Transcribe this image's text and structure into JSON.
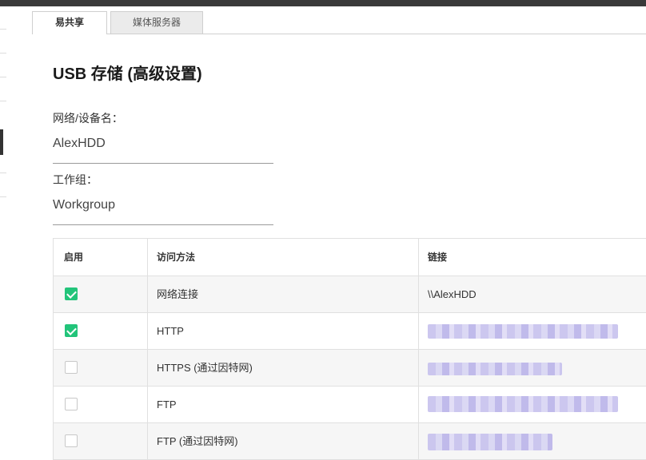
{
  "tabs": [
    {
      "label": "易共享",
      "active": true
    },
    {
      "label": "媒体服务器",
      "active": false
    }
  ],
  "page": {
    "title": "USB 存储 (高级设置)"
  },
  "fields": {
    "device_name": {
      "label": "网络/设备名：",
      "value": "AlexHDD"
    },
    "workgroup": {
      "label": "工作组：",
      "value": "Workgroup"
    }
  },
  "table": {
    "headers": {
      "enable": "启用",
      "method": "访问方法",
      "link": "链接"
    },
    "rows": [
      {
        "enabled": true,
        "method": "网络连接",
        "link": "\\\\AlexHDD",
        "link_obscured": false
      },
      {
        "enabled": true,
        "method": "HTTP",
        "link": "",
        "link_obscured": true
      },
      {
        "enabled": false,
        "method": "HTTPS (通过因特网)",
        "link": "",
        "link_obscured": true
      },
      {
        "enabled": false,
        "method": "FTP",
        "link": "",
        "link_obscured": true
      },
      {
        "enabled": false,
        "method": "FTP (通过因特网)",
        "link": "",
        "link_obscured": true
      }
    ]
  },
  "colors": {
    "checkbox_checked": "#22c47a",
    "obscured_link": "#c9c4ee",
    "top_bar": "#3a3a3a"
  }
}
